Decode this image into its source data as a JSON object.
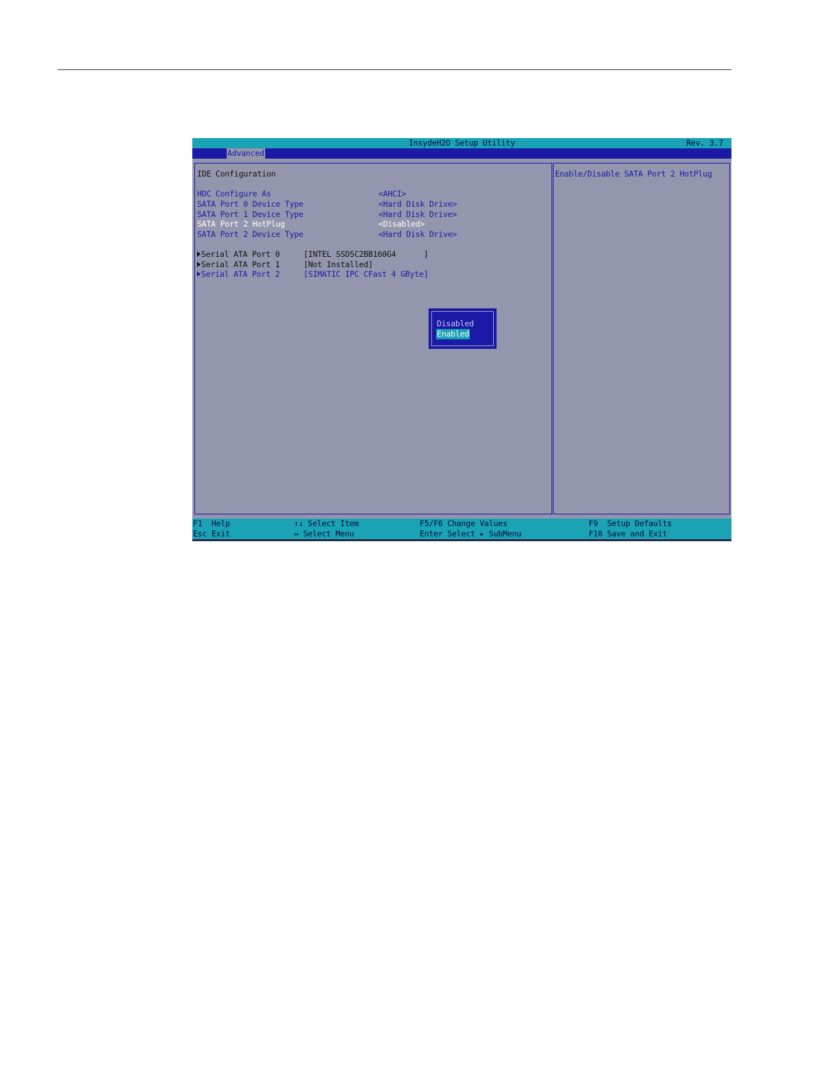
{
  "header": {
    "title": "InsydeH2O Setup Utility",
    "revision": "Rev. 3.7",
    "active_tab": "Advanced"
  },
  "main": {
    "section_title": "IDE Configuration",
    "settings": [
      {
        "label": "HDC Configure As",
        "value": "<AHCI>"
      },
      {
        "label": "SATA Port 0 Device Type",
        "value": "<Hard Disk Drive>"
      },
      {
        "label": "SATA Port 1 Device Type",
        "value": "<Hard Disk Drive>"
      },
      {
        "label": "SATA Port 2 HotPlug",
        "value": "<Disabled>"
      },
      {
        "label": "SATA Port 2 Device Type",
        "value": "<Hard Disk Drive>"
      }
    ],
    "ports": [
      {
        "label": "Serial ATA Port 0",
        "value": "[INTEL SSDSC2BB160G4      ]"
      },
      {
        "label": "Serial ATA Port 1",
        "value": "[Not Installed]"
      },
      {
        "label": "Serial ATA Port 2",
        "value": "[SIMATIC IPC CFast 4 GByte]"
      }
    ]
  },
  "help": {
    "text": "Enable/Disable SATA Port 2 HotPlug"
  },
  "popup": {
    "options": [
      "Disabled",
      "Enabled"
    ],
    "selected": "Enabled"
  },
  "status_bar": {
    "f1": "F1  Help",
    "esc": "Esc Exit",
    "select_item": "↑↓ Select Item",
    "select_menu": "↔ Select Menu",
    "change_values": "F5/F6 Change Values",
    "enter": "Enter Select ▸ SubMenu",
    "f9": "F9  Setup Defaults",
    "f10": "F10 Save and Exit"
  },
  "colors": {
    "panel_bg": "#9496ad",
    "accent_blue": "#1a1aa6",
    "bar_cyan": "#19a3b5"
  }
}
